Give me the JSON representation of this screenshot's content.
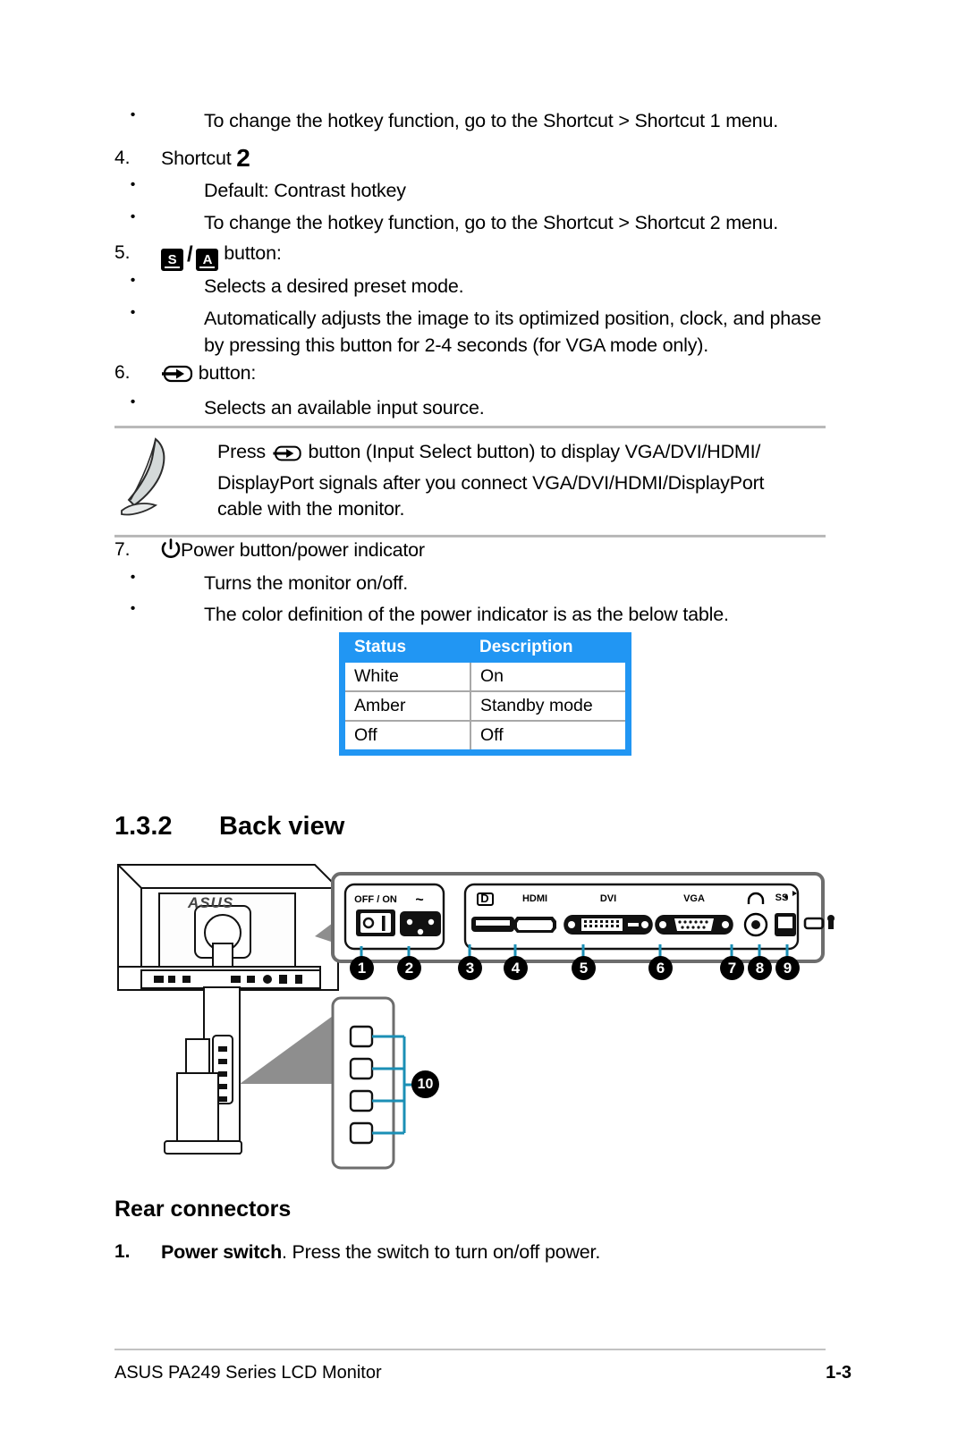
{
  "document": {
    "footer_left": "ASUS PA249 Series LCD Monitor",
    "footer_right": "1-3"
  },
  "controls_list": {
    "item_3_bullet_2": "To change the hotkey function, go to the Shortcut > Shortcut 1 menu.",
    "item_4": {
      "number": "4.",
      "label": "Shortcut",
      "label_suffix": "2",
      "bullets": [
        "Default: Contrast hotkey",
        "To change the hotkey function, go to the Shortcut > Shortcut 2 menu."
      ]
    },
    "item_5": {
      "number": "5.",
      "key_a": "S",
      "key_b": "A",
      "separator": "/",
      "label": "button:",
      "bullets": [
        "Selects a desired preset mode.",
        "Automatically adjusts the image to its optimized position, clock, and phase",
        "by pressing this button for 2-4 seconds (for VGA mode only)."
      ]
    },
    "item_6": {
      "number": "6.",
      "label": "button:",
      "bullets": [
        "Selects an available input source."
      ]
    },
    "item_7": {
      "number": "7.",
      "label": "Power button/power indicator",
      "bullets": [
        "Turns the monitor on/off.",
        "The color definition of the power indicator is as the below table."
      ]
    }
  },
  "note": {
    "line1_before": "Press",
    "line1_after": "button (Input Select button) to display VGA/DVI/HDMI/",
    "line2": "DisplayPort signals after you connect VGA/DVI/HDMI/DisplayPort",
    "line3": "cable with the monitor."
  },
  "status_table": {
    "headers": [
      "Status",
      "Description"
    ],
    "rows": [
      [
        "White",
        "On"
      ],
      [
        "Amber",
        "Standby mode"
      ],
      [
        "Off",
        "Off"
      ]
    ],
    "header_bg": "#2196f3",
    "header_text_color": "#ffffff"
  },
  "section": {
    "number": "1.3.2",
    "title": "Back view"
  },
  "rear_connectors": {
    "heading": "Rear connectors",
    "items": [
      {
        "number": "1.",
        "bold": "Power switch",
        "text": ". Press the switch to turn on/off power."
      }
    ]
  },
  "diagram": {
    "brand_logo": "ASUS",
    "power_group_labels": [
      "OFF / ON",
      "~"
    ],
    "port_labels": [
      "DP",
      "HDMI",
      "DVI",
      "VGA",
      "headphone",
      "SS-USB"
    ],
    "callouts": [
      "1",
      "2",
      "3",
      "4",
      "5",
      "6",
      "7",
      "8",
      "9",
      "10"
    ],
    "callout_line_color": "#1b8fb5"
  }
}
